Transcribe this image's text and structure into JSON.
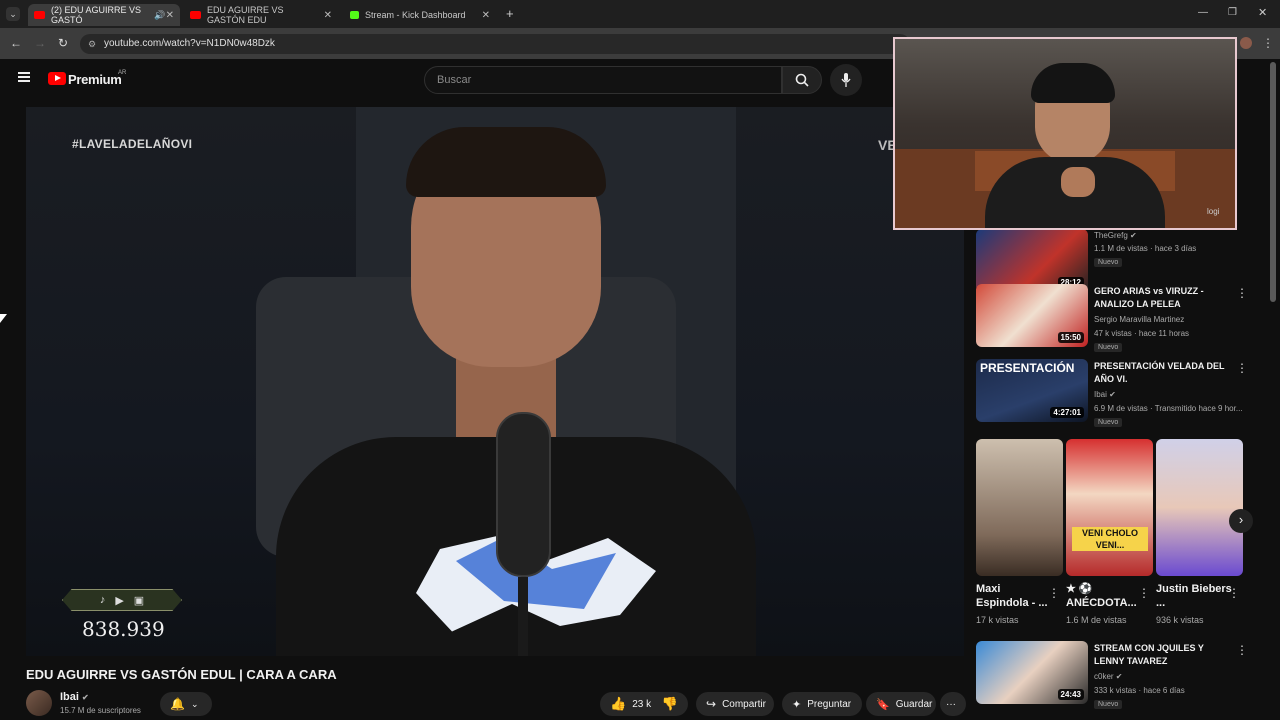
{
  "browser": {
    "tabs": [
      {
        "label": "(2) EDU AGUIRRE VS GASTÓ",
        "active": true
      },
      {
        "label": "EDU AGUIRRE VS GASTÓN EDU",
        "active": false
      },
      {
        "label": "Stream - Kick Dashboard",
        "active": false
      }
    ],
    "url": "youtube.com/watch?v=N1DN0w48Dzk",
    "new_tab": "+"
  },
  "header": {
    "logo": "Premium",
    "region": "AR",
    "search_placeholder": "Buscar"
  },
  "video": {
    "hashtag": "#LAVELADELAÑOVI",
    "counter": "838.939",
    "title": "EDU AGUIRRE VS GASTÓN EDUL | CARA A CARA",
    "channel": "Ibai",
    "subscribers": "15.7 M de suscriptores",
    "likes": "23 k",
    "share": "Compartir",
    "ask": "Preguntar",
    "save": "Guardar",
    "more": "···"
  },
  "webcam": {
    "label": "logi"
  },
  "recommendations": [
    {
      "title": "",
      "channel": "TheGrefg",
      "meta": "1.1 M de vistas · hace 3 días",
      "badge": "Nuevo",
      "duration": "28:12"
    },
    {
      "title": "GERO ARIAS vs VIRUZZ - ANALIZO LA PELEA",
      "channel": "Sergio Maravilla Martinez",
      "meta": "47 k vistas · hace 11 horas",
      "badge": "Nuevo",
      "duration": "15:50"
    },
    {
      "title": "PRESENTACIÓN VELADA DEL AÑO VI.",
      "channel": "Ibai",
      "meta": "6.9 M de vistas · Transmitido hace 9 hor...",
      "badge": "Nuevo",
      "duration": "4:27:01",
      "thumb_text": "PRESENTACIÓN"
    },
    {
      "title": "STREAM CON JQUILES Y LENNY TAVAREZ",
      "channel": "c0ker",
      "meta": "333 k vistas · hace 6 días",
      "badge": "Nuevo",
      "duration": "24:43"
    }
  ],
  "shorts": [
    {
      "title": "Maxi Espindola - ...",
      "views": "17 k vistas"
    },
    {
      "title": "★ ⚽ ANÉCDOTA...",
      "views": "1.6 M de vistas",
      "thumb_text": "VENI CHOLO VENI..."
    },
    {
      "title": "Justin Biebers ...",
      "views": "936 k vistas"
    }
  ]
}
